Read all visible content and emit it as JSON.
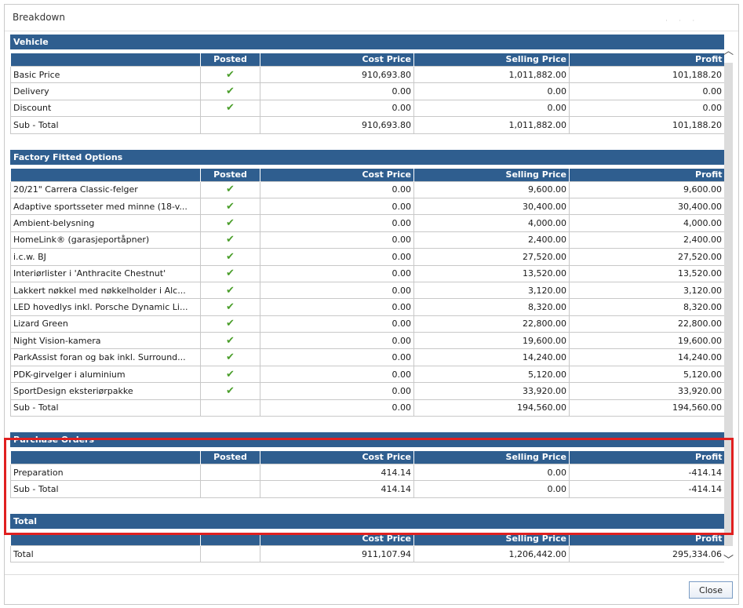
{
  "dialog": {
    "title": "Breakdown",
    "close_label": "Close"
  },
  "columns": {
    "posted": "Posted",
    "cost": "Cost Price",
    "selling": "Selling Price",
    "profit": "Profit"
  },
  "check_glyph": "✔",
  "sections": {
    "vehicle": {
      "title": "Vehicle",
      "rows": [
        {
          "name": "Basic Price",
          "posted": true,
          "cost": "910,693.80",
          "selling": "1,011,882.00",
          "profit": "101,188.20"
        },
        {
          "name": "Delivery",
          "posted": true,
          "cost": "0.00",
          "selling": "0.00",
          "profit": "0.00"
        },
        {
          "name": "Discount",
          "posted": true,
          "cost": "0.00",
          "selling": "0.00",
          "profit": "0.00"
        },
        {
          "name": "Sub - Total",
          "posted": false,
          "cost": "910,693.80",
          "selling": "1,011,882.00",
          "profit": "101,188.20"
        }
      ]
    },
    "factory": {
      "title": "Factory Fitted Options",
      "rows": [
        {
          "name": "20/21\" Carrera Classic-felger",
          "posted": true,
          "cost": "0.00",
          "selling": "9,600.00",
          "profit": "9,600.00"
        },
        {
          "name": "Adaptive sportsseter med minne (18-v...",
          "posted": true,
          "cost": "0.00",
          "selling": "30,400.00",
          "profit": "30,400.00"
        },
        {
          "name": "Ambient-belysning",
          "posted": true,
          "cost": "0.00",
          "selling": "4,000.00",
          "profit": "4,000.00"
        },
        {
          "name": "HomeLink® (garasjeportåpner)",
          "posted": true,
          "cost": "0.00",
          "selling": "2,400.00",
          "profit": "2,400.00"
        },
        {
          "name": "i.c.w. BJ",
          "posted": true,
          "cost": "0.00",
          "selling": "27,520.00",
          "profit": "27,520.00"
        },
        {
          "name": "Interiørlister i 'Anthracite Chestnut'",
          "posted": true,
          "cost": "0.00",
          "selling": "13,520.00",
          "profit": "13,520.00"
        },
        {
          "name": "Lakkert nøkkel med nøkkelholder i Alc...",
          "posted": true,
          "cost": "0.00",
          "selling": "3,120.00",
          "profit": "3,120.00"
        },
        {
          "name": "LED hovedlys inkl. Porsche Dynamic Li...",
          "posted": true,
          "cost": "0.00",
          "selling": "8,320.00",
          "profit": "8,320.00"
        },
        {
          "name": "Lizard Green",
          "posted": true,
          "cost": "0.00",
          "selling": "22,800.00",
          "profit": "22,800.00"
        },
        {
          "name": "Night Vision-kamera",
          "posted": true,
          "cost": "0.00",
          "selling": "19,600.00",
          "profit": "19,600.00"
        },
        {
          "name": "ParkAssist foran og bak inkl. Surround...",
          "posted": true,
          "cost": "0.00",
          "selling": "14,240.00",
          "profit": "14,240.00"
        },
        {
          "name": "PDK-girvelger i aluminium",
          "posted": true,
          "cost": "0.00",
          "selling": "5,120.00",
          "profit": "5,120.00"
        },
        {
          "name": "SportDesign eksteriørpakke",
          "posted": true,
          "cost": "0.00",
          "selling": "33,920.00",
          "profit": "33,920.00"
        },
        {
          "name": "Sub - Total",
          "posted": false,
          "cost": "0.00",
          "selling": "194,560.00",
          "profit": "194,560.00"
        }
      ]
    },
    "purchase": {
      "title": "Purchase Orders",
      "rows": [
        {
          "name": "Preparation",
          "posted": false,
          "cost": "414.14",
          "selling": "0.00",
          "profit": "-414.14"
        },
        {
          "name": "Sub - Total",
          "posted": false,
          "cost": "414.14",
          "selling": "0.00",
          "profit": "-414.14"
        }
      ]
    },
    "total": {
      "title": "Total",
      "rows": [
        {
          "name": "Total",
          "cost": "911,107.94",
          "selling": "1,206,442.00",
          "profit": "295,334.06"
        }
      ]
    }
  },
  "colors": {
    "header_bg": "#2f5e8f",
    "check": "#4a9e2a",
    "highlight": "#e02020"
  },
  "icons": {
    "scroll_up": "chevron-up-icon",
    "scroll_down": "chevron-down-icon"
  }
}
